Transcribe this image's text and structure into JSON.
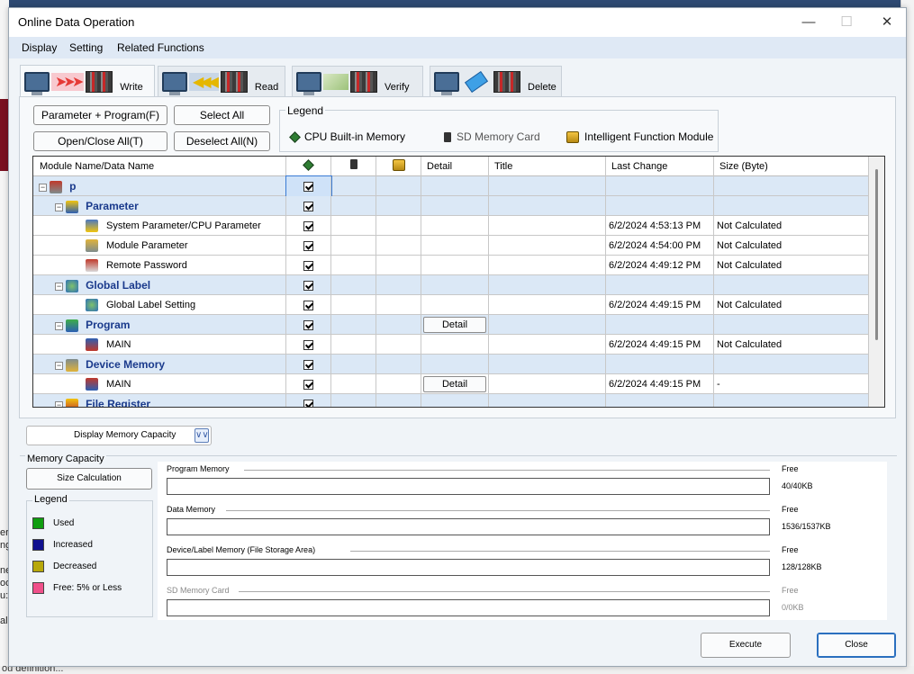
{
  "window": {
    "title": "Online Data Operation"
  },
  "menu": [
    "Display",
    "Setting",
    "Related Functions"
  ],
  "tabs": [
    {
      "label": "Write",
      "active": true
    },
    {
      "label": "Read",
      "active": false
    },
    {
      "label": "Verify",
      "active": false
    },
    {
      "label": "Delete",
      "active": false
    }
  ],
  "buttons": {
    "param_program": "Parameter + Program(F)",
    "select_all": "Select All",
    "open_close_all": "Open/Close All(T)",
    "deselect_all": "Deselect All(N)"
  },
  "legend": {
    "title": "Legend",
    "cpu": "CPU Built-in Memory",
    "sd": "SD Memory Card",
    "ifm": "Intelligent Function Module"
  },
  "grid": {
    "headers": [
      "Module Name/Data Name",
      "",
      "",
      "",
      "Detail",
      "Title",
      "Last Change",
      "Size (Byte)"
    ],
    "rows": [
      {
        "level": 0,
        "group": true,
        "name": "p",
        "checked": true,
        "detail": "",
        "last_change": "",
        "size": "",
        "icon": "project-icon"
      },
      {
        "level": 1,
        "group": true,
        "name": "Parameter",
        "checked": true,
        "detail": "",
        "last_change": "",
        "size": "",
        "icon": "parameter-icon"
      },
      {
        "level": 2,
        "group": false,
        "name": "System Parameter/CPU Parameter",
        "checked": true,
        "detail": "",
        "last_change": "6/2/2024 4:53:13 PM",
        "size": "Not Calculated",
        "icon": "system-parameter-icon"
      },
      {
        "level": 2,
        "group": false,
        "name": "Module Parameter",
        "checked": true,
        "detail": "",
        "last_change": "6/2/2024 4:54:00 PM",
        "size": "Not Calculated",
        "icon": "module-parameter-icon"
      },
      {
        "level": 2,
        "group": false,
        "name": "Remote Password",
        "checked": true,
        "detail": "",
        "last_change": "6/2/2024 4:49:12 PM",
        "size": "Not Calculated",
        "icon": "remote-password-icon"
      },
      {
        "level": 1,
        "group": true,
        "name": "Global Label",
        "checked": true,
        "detail": "",
        "last_change": "",
        "size": "",
        "icon": "global-label-icon"
      },
      {
        "level": 2,
        "group": false,
        "name": "Global Label Setting",
        "checked": true,
        "detail": "",
        "last_change": "6/2/2024 4:49:15 PM",
        "size": "Not Calculated",
        "icon": "global-label-setting-icon"
      },
      {
        "level": 1,
        "group": true,
        "name": "Program",
        "checked": true,
        "detail": "Detail",
        "last_change": "",
        "size": "",
        "icon": "program-icon"
      },
      {
        "level": 2,
        "group": false,
        "name": "MAIN",
        "checked": true,
        "detail": "",
        "last_change": "6/2/2024 4:49:15 PM",
        "size": "Not Calculated",
        "icon": "program-file-icon"
      },
      {
        "level": 1,
        "group": true,
        "name": "Device Memory",
        "checked": true,
        "detail": "",
        "last_change": "",
        "size": "",
        "icon": "device-memory-icon"
      },
      {
        "level": 2,
        "group": false,
        "name": "MAIN",
        "checked": true,
        "detail": "Detail",
        "last_change": "6/2/2024 4:49:15 PM",
        "size": "-",
        "icon": "device-memory-file-icon"
      },
      {
        "level": 1,
        "group": true,
        "name": "File Register",
        "checked": true,
        "detail": "",
        "last_change": "",
        "size": "",
        "icon": "file-register-icon"
      }
    ]
  },
  "display_memory_capacity": "Display Memory Capacity",
  "memory_capacity": {
    "title": "Memory Capacity",
    "size_calc": "Size Calculation",
    "legend_title": "Legend",
    "legend_items": [
      {
        "label": "Used",
        "color": "#0f9d0f"
      },
      {
        "label": "Increased",
        "color": "#10108f"
      },
      {
        "label": "Decreased",
        "color": "#b8a80a"
      },
      {
        "label": "Free: 5% or Less",
        "color": "#f0508a"
      }
    ],
    "rows": [
      {
        "name": "Program Memory",
        "free_label": "Free",
        "value": "40/40KB",
        "dim": false
      },
      {
        "name": "Data Memory",
        "free_label": "Free",
        "value": "1536/1537KB",
        "dim": false
      },
      {
        "name": "Device/Label Memory (File Storage Area)",
        "free_label": "Free",
        "value": "128/128KB",
        "dim": false
      },
      {
        "name": "SD Memory Card",
        "free_label": "Free",
        "value": "0/0KB",
        "dim": true
      }
    ]
  },
  "footer": {
    "execute": "Execute",
    "close": "Close"
  },
  "background": {
    "bottom_text": "ou definition...",
    "left_fragments": [
      "er",
      "ng",
      "ne",
      "oo",
      "u:",
      "al"
    ]
  }
}
